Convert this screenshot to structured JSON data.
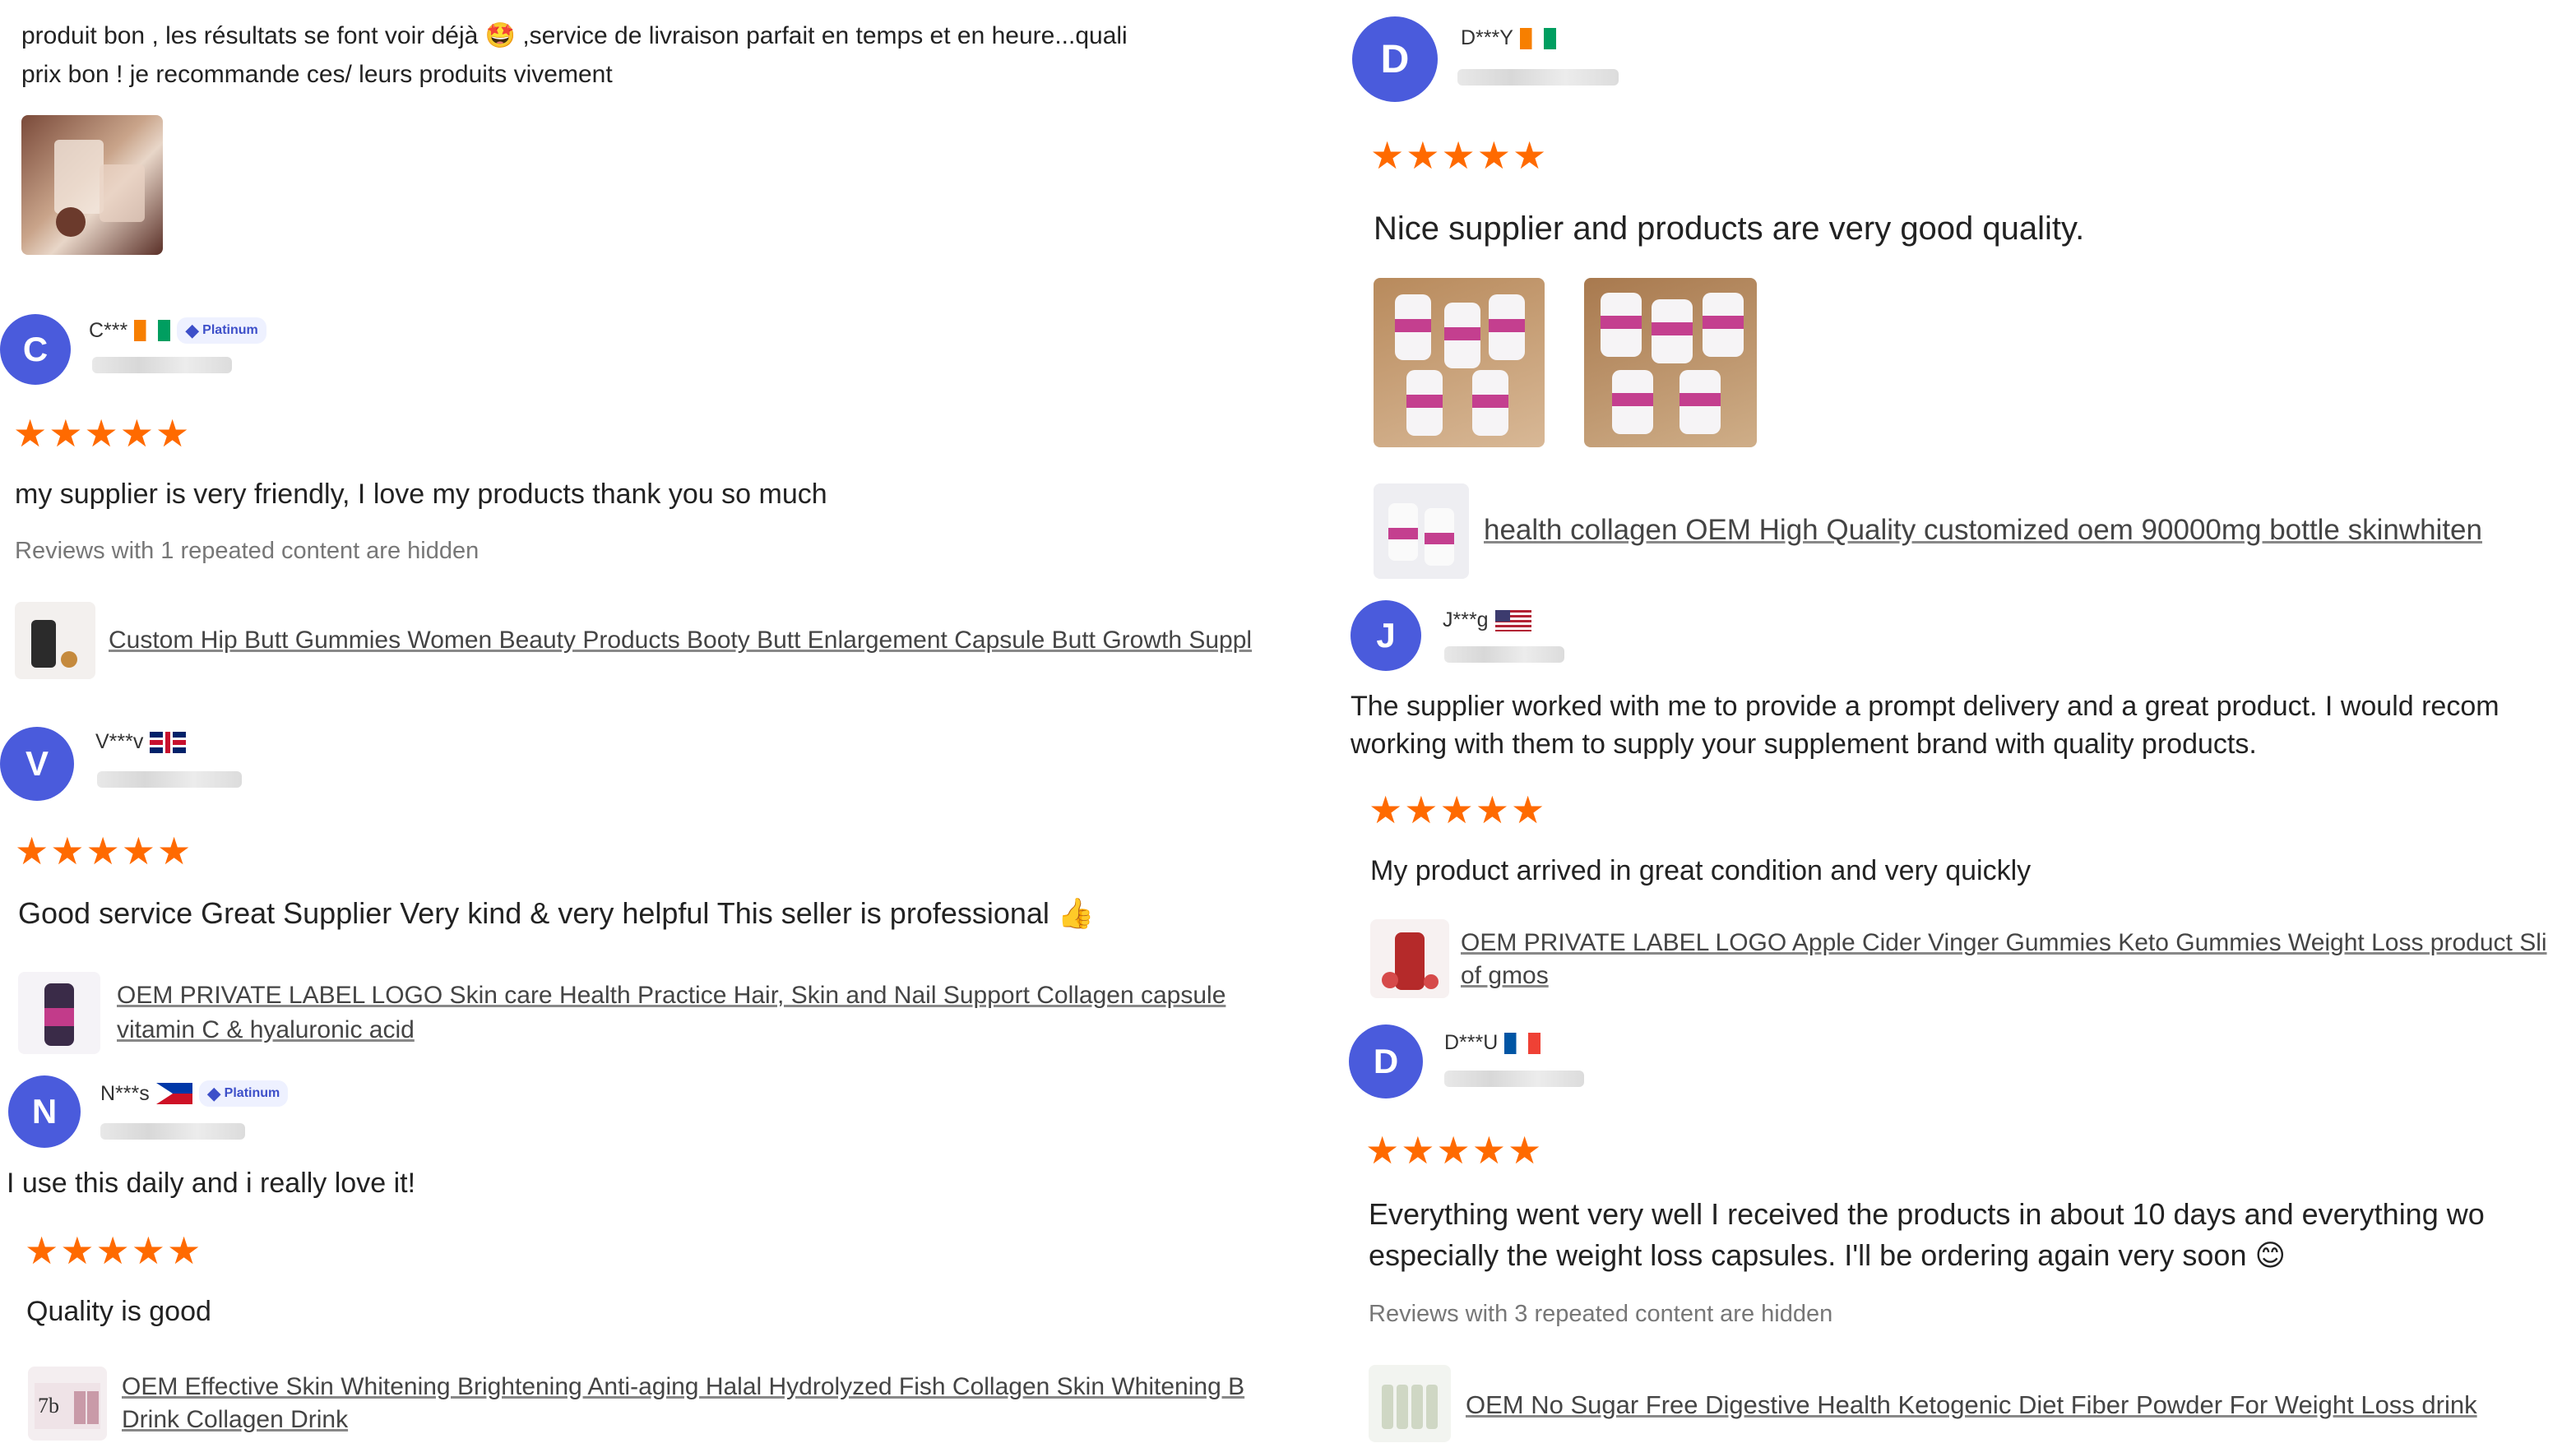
{
  "colors": {
    "avatar": "#4a5bdc",
    "star": "#ff6a00",
    "link": "#444444",
    "meta": "#777777"
  },
  "reviews": [
    {
      "review_text": "produit bon , les résultats se font voir déjà 🤩 ,service de livraison parfait en temps et en heure...quali",
      "review_text_line2": "prix bon ! je recommande ces/ leurs produits vivement"
    },
    {
      "avatar": "C",
      "user": "C***",
      "flag": "flag-ci",
      "badge": "Platinum",
      "stars": "★★★★★",
      "review_text": "my supplier is very friendly, I love my products thank you so much",
      "hidden_note": "Reviews with 1 repeated content are hidden",
      "product": "Custom Hip Butt Gummies Women Beauty Products Booty Butt Enlargement Capsule Butt Growth Suppl"
    },
    {
      "avatar": "V",
      "user": "V***v",
      "flag": "flag-gb",
      "stars": "★★★★★",
      "review_text": "Good service Great Supplier Very kind & very helpful This seller is professional 👍",
      "product": "OEM PRIVATE LABEL LOGO Skin care Health Practice Hair, Skin and Nail Support Collagen capsule",
      "product_line2": "vitamin C & hyaluronic acid"
    },
    {
      "avatar": "N",
      "user": "N***s",
      "flag": "flag-ph",
      "badge": "Platinum",
      "pre_text": "I use this daily and i really love it!",
      "stars": "★★★★★",
      "review_text": "Quality is good",
      "product": "OEM Effective Skin Whitening Brightening Anti-aging Halal Hydrolyzed Fish Collagen Skin Whitening B",
      "product_line2": "Drink Collagen Drink"
    },
    {
      "avatar": "D",
      "user": "D***Y",
      "flag": "flag-ci",
      "stars": "★★★★★",
      "review_text": "Nice supplier and products are very good quality.",
      "product": "health collagen OEM High Quality customized oem 90000mg bottle skinwhiten"
    },
    {
      "avatar": "J",
      "user": "J***g",
      "flag": "flag-us",
      "pre_text": "The supplier worked with me to provide a prompt delivery and a great product. I would recom",
      "pre_text_line2": "working with them to supply your supplement brand with quality products.",
      "stars": "★★★★★",
      "review_text": "My product arrived in great condition and very quickly",
      "product": "OEM PRIVATE LABEL LOGO Apple Cider Vinger Gummies Keto Gummies Weight Loss product Sli",
      "product_line2": "of gmos"
    },
    {
      "avatar": "D",
      "user": "D***U",
      "flag": "flag-fr",
      "stars": "★★★★★",
      "review_text": "Everything went very well I received the products in about 10 days and everything wo",
      "review_text_line2": "especially the weight loss capsules. I'll be ordering again very soon 😊",
      "hidden_note": "Reviews with 3 repeated content are hidden",
      "product": "OEM No Sugar Free Digestive Health Ketogenic Diet Fiber Powder For Weight Loss drink"
    }
  ]
}
